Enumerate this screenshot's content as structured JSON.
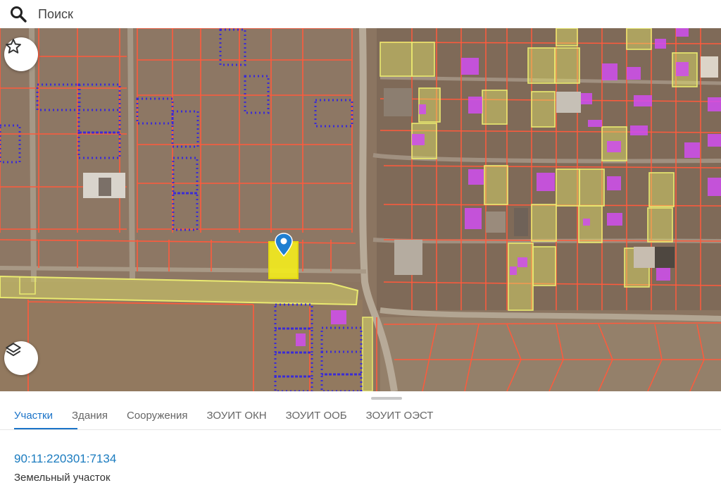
{
  "search": {
    "placeholder": "Поиск"
  },
  "map": {
    "icons": {
      "favorite": "star-icon",
      "layers": "layers-icon",
      "marker": "map-pin-icon"
    },
    "colors": {
      "boundary": "#ff5a3c",
      "selected_fill": "#f2ea1e",
      "road_zone": "#e8e86a",
      "building": "#d04ef0",
      "zone_dots": "#3a2bd6"
    }
  },
  "tabs": [
    {
      "label": "Участки",
      "active": true
    },
    {
      "label": "Здания",
      "active": false
    },
    {
      "label": "Сооружения",
      "active": false
    },
    {
      "label": "ЗОУИТ ОКН",
      "active": false
    },
    {
      "label": "ЗОУИТ ООБ",
      "active": false
    },
    {
      "label": "ЗОУИТ ОЭСТ",
      "active": false
    }
  ],
  "parcel": {
    "cadastral_number": "90:11:220301:7134",
    "type": "Земельный участок"
  }
}
